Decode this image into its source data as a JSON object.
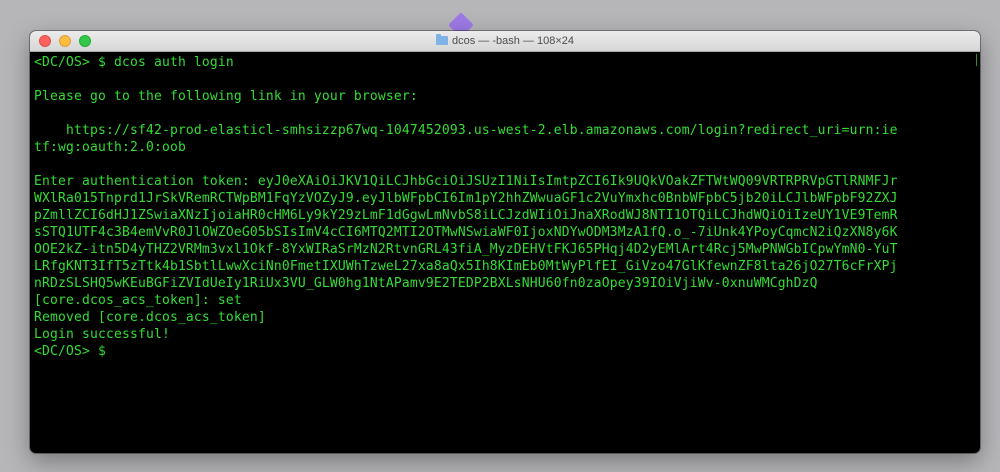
{
  "window": {
    "title": "dcos — -bash — 108×24",
    "folder_icon": "folder-icon",
    "buttons": [
      "close",
      "minimize",
      "maximize"
    ],
    "colors": {
      "background": "#000000",
      "text": "#33dd33",
      "close": "#fc605c",
      "minimize": "#fdbc40",
      "maximize": "#34c84a"
    }
  },
  "terminal": {
    "lines": [
      "<DC/OS> $ dcos auth login",
      "",
      "Please go to the following link in your browser:",
      "",
      "    https://sf42-prod-elasticl-smhsizzp67wq-1047452093.us-west-2.elb.amazonaws.com/login?redirect_uri=urn:ie",
      "tf:wg:oauth:2.0:oob",
      "",
      "Enter authentication token: eyJ0eXAiOiJKV1QiLCJhbGciOiJSUzI1NiIsImtpZCI6Ik9UQkVOakZFTWtWQ09VRTRPRVpGTlRNMFJr",
      "WXlRa015Tnprd1JrSkVRemRCTWpBM1FqYzVOZyJ9.eyJlbWFpbCI6Im1pY2hhZWwuaGF1c2VuYmxhc0BnbWFpbC5jb20iLCJlbWFpbF92ZXJ",
      "pZmllZCI6dHJ1ZSwiaXNzIjoiaHR0cHM6Ly9kY29zLmF1dGgwLmNvbS8iLCJzdWIiOiJnaXRodWJ8NTI1OTQiLCJhdWQiOiIzeUY1VE9TemR",
      "sSTQ1UTF4c3B4emVvR0JlOWZOeG05bSIsImV4cCI6MTQ2MTI2OTMwNSwiaWF0IjoxNDYwODM3MzA1fQ.o_-7iUnk4YPoyCqmcN2iQzXN8y6K",
      "OOE2kZ-itn5D4yTHZ2VRMm3vxl1Okf-8YxWIRaSrMzN2RtvnGRL43fiA_MyzDEHVtFKJ65PHqj4D2yEMlArt4Rcj5MwPNWGbICpwYmN0-YuT",
      "LRfgKNT3IfT5zTtk4b1SbtlLwwXciNn0FmetIXUWhTzweL27xa8aQx5Ih8KImEb0MtWyPlfEI_GiVzo47GlKfewnZF8lta26jO27T6cFrXPj",
      "nRDzSLSHQ5wKEuBGFiZVIdUeIy1RiUx3VU_GLW0hg1NtAPamv9E2TEDP2BXLsNHU60fn0zaOpey39IOiVjiWv-0xnuWMCghDzQ",
      "[core.dcos_acs_token]: set",
      "Removed [core.dcos_acs_token]",
      "Login successful!",
      "<DC/OS> $"
    ]
  }
}
